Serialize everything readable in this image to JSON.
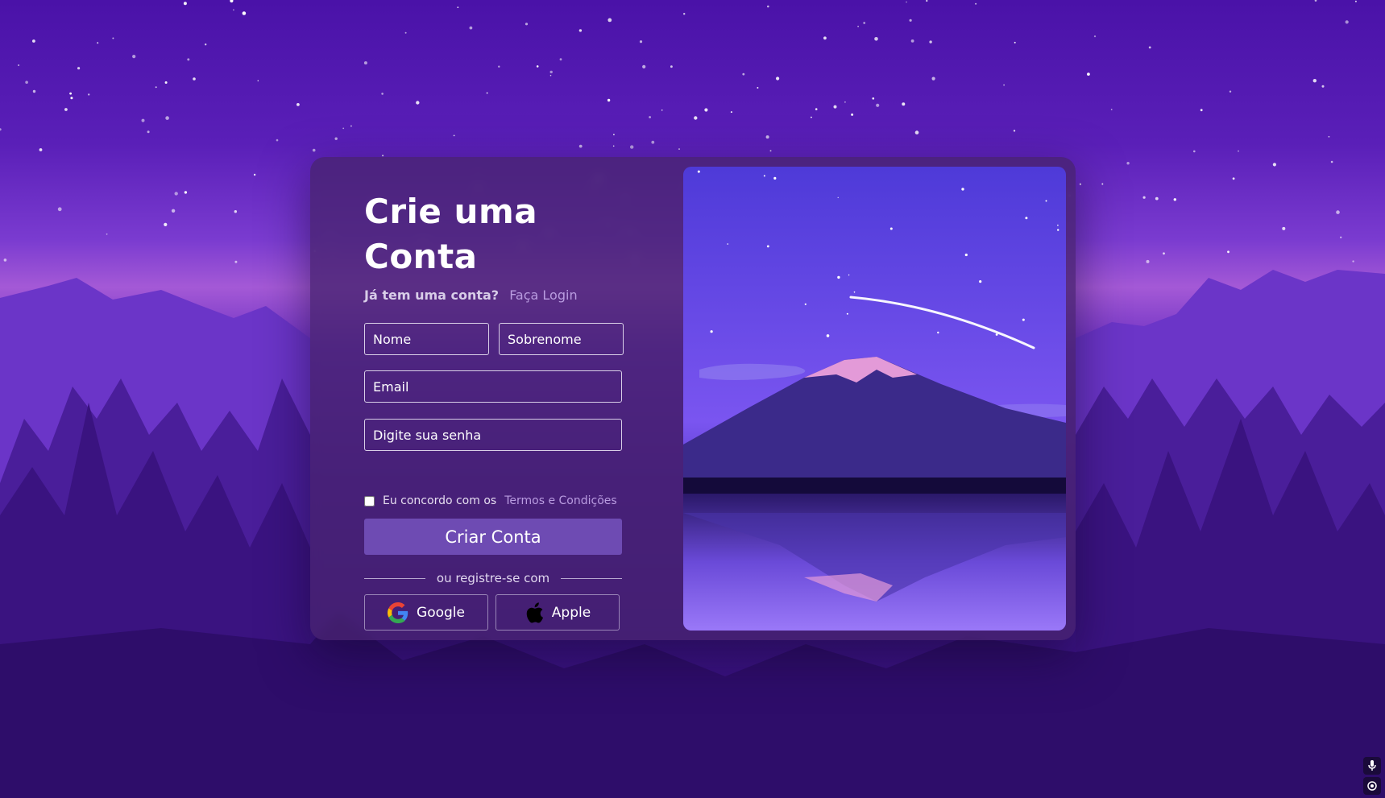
{
  "form": {
    "title": "Crie uma Conta",
    "have_account": "Já tem uma conta?",
    "login_link": "Faça Login",
    "first_name_placeholder": "Nome",
    "last_name_placeholder": "Sobrenome",
    "email_placeholder": "Email",
    "password_placeholder": "Digite sua senha",
    "agree_text": "Eu concordo com os",
    "terms_link": "Termos e Condições",
    "submit_label": "Criar Conta",
    "divider_text": "ou registre-se com",
    "google_label": "Google",
    "apple_label": "Apple"
  },
  "icons": {
    "google": "google-icon",
    "apple": "apple-icon",
    "mic": "microphone-icon",
    "location": "location-icon"
  },
  "colors": {
    "accent": "#6e4bb3",
    "link": "#b99ce0",
    "card": "#46236e"
  }
}
